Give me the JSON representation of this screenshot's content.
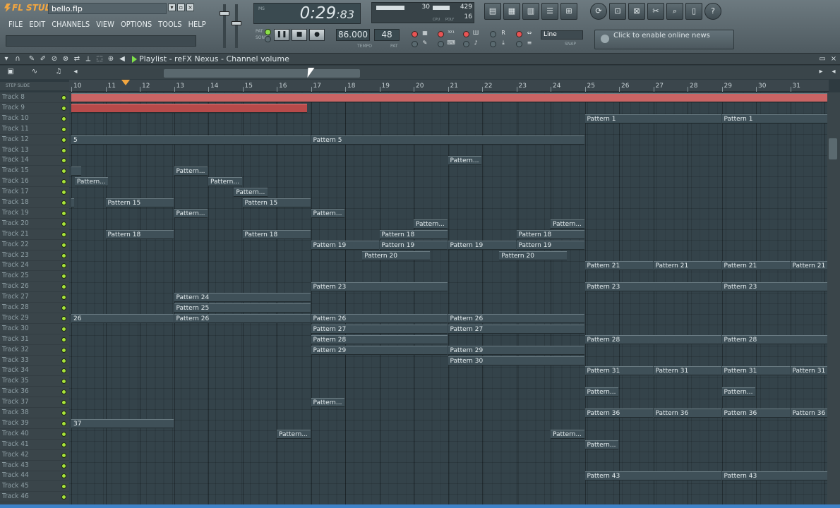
{
  "app": {
    "logo": "FL STUDIO",
    "file": "bello.flp"
  },
  "window_buttons": [
    "▾",
    "▫",
    "×"
  ],
  "menu": [
    "FILE",
    "EDIT",
    "CHANNELS",
    "VIEW",
    "OPTIONS",
    "TOOLS",
    "HELP"
  ],
  "transport": {
    "time": "0:29",
    "time_ms": ":83",
    "ms_label": "MS",
    "tempo": "86.000",
    "tempo_label": "TEMPO",
    "pattern": "48",
    "pattern_label": "PAT",
    "pat_label": "PAT",
    "song_label": "SONG"
  },
  "monitor": {
    "val1": "30",
    "val2": "429",
    "val3": "16",
    "cpu_label": "CPU",
    "poly_label": "POLY"
  },
  "snap": {
    "value": "Line",
    "label": "SNAP"
  },
  "news": {
    "text": "Click to enable online news"
  },
  "playlist_title": "Playlist - reFX Nexus - Channel volume",
  "step_slide": "STEP   SLIDE",
  "ruler_bars": [
    "10",
    "11",
    "12",
    "13",
    "14",
    "15",
    "16",
    "17",
    "18",
    "19",
    "20",
    "21",
    "22",
    "23",
    "24",
    "25",
    "26",
    "27",
    "28",
    "29",
    "30",
    "31"
  ],
  "tracks": [
    "Track 8",
    "Track 9",
    "Track 10",
    "Track 11",
    "Track 12",
    "Track 13",
    "Track 14",
    "Track 15",
    "Track 16",
    "Track 17",
    "Track 18",
    "Track 19",
    "Track 20",
    "Track 21",
    "Track 22",
    "Track 23",
    "Track 24",
    "Track 25",
    "Track 26",
    "Track 27",
    "Track 28",
    "Track 29",
    "Track 30",
    "Track 31",
    "Track 32",
    "Track 33",
    "Track 34",
    "Track 35",
    "Track 36",
    "Track 37",
    "Track 38",
    "Track 39",
    "Track 40",
    "Track 41",
    "Track 42",
    "Track 43",
    "Track 44",
    "Track 45",
    "Track 46"
  ],
  "clips": [
    {
      "row": 0,
      "bar": 10,
      "len": 22.2,
      "label": "",
      "style": "red"
    },
    {
      "row": 1,
      "bar": 10,
      "len": 6.9,
      "label": "",
      "style": "sel"
    },
    {
      "row": 2,
      "bar": 25,
      "len": 4,
      "label": "Pattern 1"
    },
    {
      "row": 2,
      "bar": 29,
      "len": 3.2,
      "label": "Pattern 1"
    },
    {
      "row": 4,
      "bar": 10,
      "len": 7,
      "label": "5"
    },
    {
      "row": 4,
      "bar": 17,
      "len": 8,
      "label": "Pattern 5"
    },
    {
      "row": 6,
      "bar": 21,
      "len": 1,
      "label": "Pattern..."
    },
    {
      "row": 7,
      "bar": 10,
      "len": 0.3,
      "label": ""
    },
    {
      "row": 7,
      "bar": 13,
      "len": 1,
      "label": "Pattern..."
    },
    {
      "row": 8,
      "bar": 10.1,
      "len": 1,
      "label": "Pattern..."
    },
    {
      "row": 8,
      "bar": 14,
      "len": 1,
      "label": "Pattern..."
    },
    {
      "row": 9,
      "bar": 14.75,
      "len": 1,
      "label": "Pattern..."
    },
    {
      "row": 10,
      "bar": 10,
      "len": 0.1,
      "label": ""
    },
    {
      "row": 10,
      "bar": 11,
      "len": 2,
      "label": "Pattern 15"
    },
    {
      "row": 10,
      "bar": 15,
      "len": 2,
      "label": "Pattern 15"
    },
    {
      "row": 11,
      "bar": 13,
      "len": 1,
      "label": "Pattern..."
    },
    {
      "row": 11,
      "bar": 17,
      "len": 1,
      "label": "Pattern..."
    },
    {
      "row": 12,
      "bar": 20,
      "len": 1,
      "label": "Pattern..."
    },
    {
      "row": 12,
      "bar": 24,
      "len": 1,
      "label": "Pattern..."
    },
    {
      "row": 13,
      "bar": 11,
      "len": 2,
      "label": "Pattern 18"
    },
    {
      "row": 13,
      "bar": 15,
      "len": 2,
      "label": "Pattern 18"
    },
    {
      "row": 13,
      "bar": 19,
      "len": 2,
      "label": "Pattern 18"
    },
    {
      "row": 13,
      "bar": 23,
      "len": 2,
      "label": "Pattern 18"
    },
    {
      "row": 14,
      "bar": 17,
      "len": 2,
      "label": "Pattern 19"
    },
    {
      "row": 14,
      "bar": 19,
      "len": 2,
      "label": "Pattern 19"
    },
    {
      "row": 14,
      "bar": 21,
      "len": 2,
      "label": "Pattern 19"
    },
    {
      "row": 14,
      "bar": 23,
      "len": 2,
      "label": "Pattern 19"
    },
    {
      "row": 15,
      "bar": 18.5,
      "len": 2,
      "label": "Pattern 20"
    },
    {
      "row": 15,
      "bar": 22.5,
      "len": 2,
      "label": "Pattern 20"
    },
    {
      "row": 16,
      "bar": 25,
      "len": 2,
      "label": "Pattern 21"
    },
    {
      "row": 16,
      "bar": 27,
      "len": 2,
      "label": "Pattern 21"
    },
    {
      "row": 16,
      "bar": 29,
      "len": 2,
      "label": "Pattern 21"
    },
    {
      "row": 16,
      "bar": 31,
      "len": 1.1,
      "label": "Pattern 21"
    },
    {
      "row": 18,
      "bar": 17,
      "len": 4,
      "label": "Pattern 23"
    },
    {
      "row": 18,
      "bar": 25,
      "len": 4,
      "label": "Pattern 23"
    },
    {
      "row": 18,
      "bar": 29,
      "len": 3.2,
      "label": "Pattern 23"
    },
    {
      "row": 19,
      "bar": 13,
      "len": 4,
      "label": "Pattern 24"
    },
    {
      "row": 20,
      "bar": 13,
      "len": 4,
      "label": "Pattern 25"
    },
    {
      "row": 21,
      "bar": 10,
      "len": 3,
      "label": "26"
    },
    {
      "row": 21,
      "bar": 13,
      "len": 4,
      "label": "Pattern 26"
    },
    {
      "row": 21,
      "bar": 17,
      "len": 4,
      "label": "Pattern 26"
    },
    {
      "row": 21,
      "bar": 21,
      "len": 4,
      "label": "Pattern 26"
    },
    {
      "row": 22,
      "bar": 17,
      "len": 4,
      "label": "Pattern 27"
    },
    {
      "row": 22,
      "bar": 21,
      "len": 4,
      "label": "Pattern 27"
    },
    {
      "row": 23,
      "bar": 17,
      "len": 4,
      "label": "Pattern 28"
    },
    {
      "row": 23,
      "bar": 25,
      "len": 4,
      "label": "Pattern 28"
    },
    {
      "row": 23,
      "bar": 29,
      "len": 3.2,
      "label": "Pattern 28"
    },
    {
      "row": 24,
      "bar": 17,
      "len": 4,
      "label": "Pattern 29"
    },
    {
      "row": 24,
      "bar": 21,
      "len": 4,
      "label": "Pattern 29"
    },
    {
      "row": 25,
      "bar": 21,
      "len": 4,
      "label": "Pattern 30"
    },
    {
      "row": 26,
      "bar": 25,
      "len": 2,
      "label": "Pattern 31"
    },
    {
      "row": 26,
      "bar": 27,
      "len": 2,
      "label": "Pattern 31"
    },
    {
      "row": 26,
      "bar": 29,
      "len": 2,
      "label": "Pattern 31"
    },
    {
      "row": 26,
      "bar": 31,
      "len": 1.1,
      "label": "Pattern 31"
    },
    {
      "row": 28,
      "bar": 25,
      "len": 1,
      "label": "Pattern..."
    },
    {
      "row": 28,
      "bar": 29,
      "len": 1,
      "label": "Pattern..."
    },
    {
      "row": 29,
      "bar": 17,
      "len": 1,
      "label": "Pattern..."
    },
    {
      "row": 30,
      "bar": 25,
      "len": 2,
      "label": "Pattern 36"
    },
    {
      "row": 30,
      "bar": 27,
      "len": 2,
      "label": "Pattern 36"
    },
    {
      "row": 30,
      "bar": 29,
      "len": 2,
      "label": "Pattern 36"
    },
    {
      "row": 30,
      "bar": 31,
      "len": 1.1,
      "label": "Pattern 36"
    },
    {
      "row": 31,
      "bar": 10,
      "len": 3,
      "label": "37"
    },
    {
      "row": 32,
      "bar": 16,
      "len": 1,
      "label": "Pattern..."
    },
    {
      "row": 32,
      "bar": 24,
      "len": 1,
      "label": "Pattern..."
    },
    {
      "row": 33,
      "bar": 25,
      "len": 1,
      "label": "Pattern..."
    },
    {
      "row": 36,
      "bar": 25,
      "len": 4,
      "label": "Pattern 43"
    },
    {
      "row": 36,
      "bar": 29,
      "len": 3.2,
      "label": "Pattern 43"
    }
  ]
}
